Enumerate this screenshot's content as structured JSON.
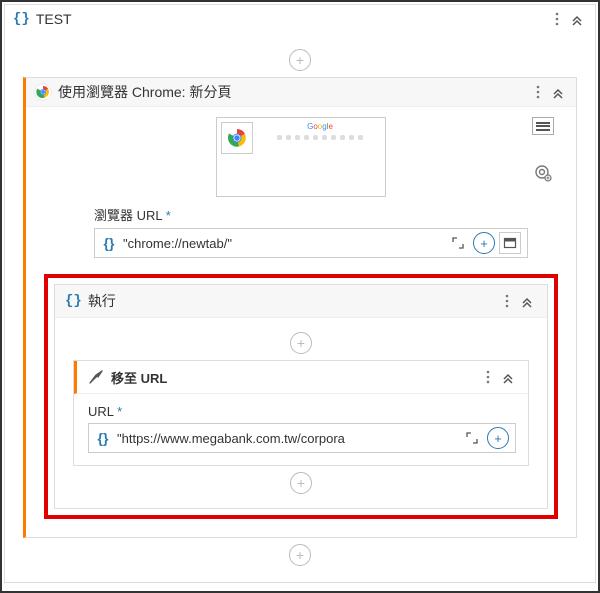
{
  "root": {
    "title": "TEST"
  },
  "chromePanel": {
    "title": "使用瀏覽器 Chrome: 新分頁",
    "previewLabel": "Google",
    "urlField": {
      "label": "瀏覽器 URL",
      "value": "\"chrome://newtab/\""
    }
  },
  "execPanel": {
    "title": "執行",
    "navigate": {
      "title": "移至 URL",
      "urlField": {
        "label": "URL",
        "value": "\"https://www.megabank.com.tw/corpora"
      }
    }
  },
  "icons": {
    "braces": "{}",
    "plus": "+",
    "star": "*"
  }
}
